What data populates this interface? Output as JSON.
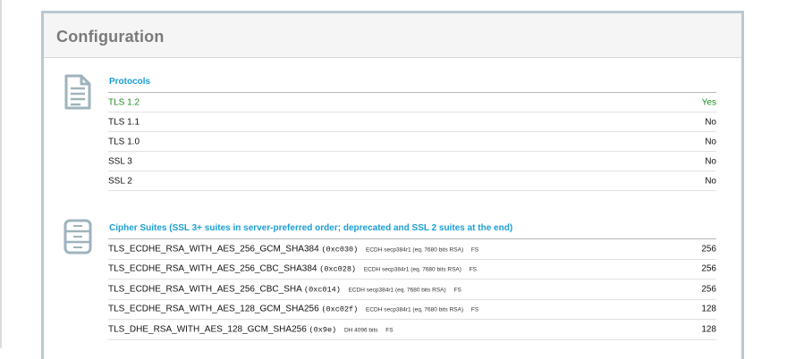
{
  "panel": {
    "title": "Configuration"
  },
  "protocols": {
    "title": "Protocols",
    "icon": "document-icon",
    "rows": [
      {
        "name": "TLS 1.2",
        "value": "Yes",
        "enabled": true
      },
      {
        "name": "TLS 1.1",
        "value": "No",
        "enabled": false
      },
      {
        "name": "TLS 1.0",
        "value": "No",
        "enabled": false
      },
      {
        "name": "SSL 3",
        "value": "No",
        "enabled": false
      },
      {
        "name": "SSL 2",
        "value": "No",
        "enabled": false
      }
    ]
  },
  "cipher_suites": {
    "title": "Cipher Suites (SSL 3+ suites in server-preferred order; deprecated and SSL 2 suites at the end)",
    "icon": "cabinet-icon",
    "rows": [
      {
        "name": "TLS_ECDHE_RSA_WITH_AES_256_GCM_SHA384",
        "code": "(0xc030)",
        "kex": "ECDH secp384r1 (eq. 7680 bits RSA)",
        "fs": "FS",
        "bits": "256"
      },
      {
        "name": "TLS_ECDHE_RSA_WITH_AES_256_CBC_SHA384",
        "code": "(0xc028)",
        "kex": "ECDH secp384r1 (eq. 7680 bits RSA)",
        "fs": "FS",
        "bits": "256"
      },
      {
        "name": "TLS_ECDHE_RSA_WITH_AES_256_CBC_SHA",
        "code": "(0xc014)",
        "kex": "ECDH secp384r1 (eq. 7680 bits RSA)",
        "fs": "FS",
        "bits": "256"
      },
      {
        "name": "TLS_ECDHE_RSA_WITH_AES_128_GCM_SHA256",
        "code": "(0xc02f)",
        "kex": "ECDH secp384r1 (eq. 7680 bits RSA)",
        "fs": "FS",
        "bits": "128"
      },
      {
        "name": "TLS_DHE_RSA_WITH_AES_128_GCM_SHA256",
        "code": "(0x9e)",
        "kex": "DH 4096 bits",
        "fs": "FS",
        "bits": "128"
      }
    ]
  },
  "colors": {
    "section_title": "#1a9ed5",
    "yes": "#1c8c1c",
    "panel_border": "#b7c9d0",
    "header_title": "#7a7a7a"
  }
}
